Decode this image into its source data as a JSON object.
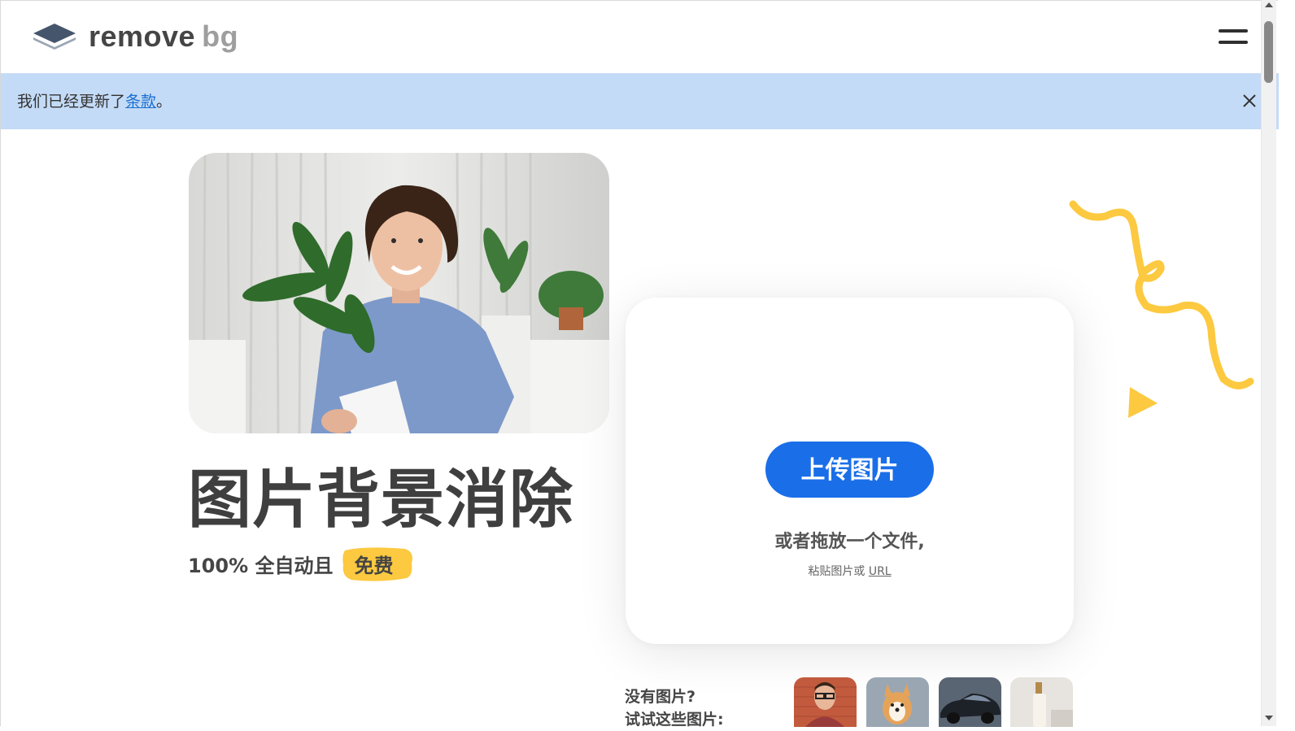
{
  "header": {
    "logo_word_1": "remove",
    "logo_word_2": "bg",
    "menu_icon": "hamburger-icon"
  },
  "notice": {
    "text_before": "我们已经更新了",
    "link_text": "条款",
    "text_after": "。",
    "close_icon": "close-icon"
  },
  "hero": {
    "title": "图片背景消除",
    "subtitle": "100% 全自动且",
    "badge": "免费"
  },
  "upload": {
    "button_label": "上传图片",
    "drop_text": "或者拖放一个文件,",
    "paste_text": "粘贴图片或",
    "url_link": "URL"
  },
  "samples": {
    "no_image": "没有图片?",
    "try_image": "试试这些图片:"
  },
  "colors": {
    "accent": "#1a6ee8",
    "notice_bg": "#c4dbf7",
    "badge_yellow": "#fcc940",
    "decoration_yellow": "#fcc940",
    "text": "#454545"
  }
}
